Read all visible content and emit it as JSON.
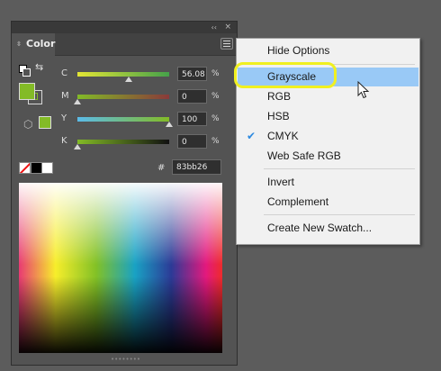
{
  "panel": {
    "tab_label": "Color",
    "tab_arrows": "⇳",
    "collapse_glyph": "‹‹",
    "close_glyph": "×",
    "fill_color": "#83bb26",
    "sliders": [
      {
        "key": "C",
        "value": "56.08",
        "unit": "%",
        "level": 0.56,
        "gradient": "linear-gradient(to right,#e3e635,#45a14a)"
      },
      {
        "key": "M",
        "value": "0",
        "unit": "%",
        "level": 0.0,
        "gradient": "linear-gradient(to right,#82ba27,#8a3a3a)"
      },
      {
        "key": "Y",
        "value": "100",
        "unit": "%",
        "level": 1.0,
        "gradient": "linear-gradient(to right,#5bbbe8,#83bb26)"
      },
      {
        "key": "K",
        "value": "0",
        "unit": "%",
        "level": 0.0,
        "gradient": "linear-gradient(to right,#83bb26,#111111)"
      }
    ],
    "hash_label": "#",
    "hex_value": "83bb26",
    "grip": "••••••••"
  },
  "menu": {
    "items": [
      {
        "label": "Hide Options",
        "checked": false,
        "highlighted": false
      },
      {
        "label": "Grayscale",
        "checked": false,
        "highlighted": true
      },
      {
        "label": "RGB",
        "checked": false,
        "highlighted": false
      },
      {
        "label": "HSB",
        "checked": false,
        "highlighted": false
      },
      {
        "label": "CMYK",
        "checked": true,
        "highlighted": false
      },
      {
        "label": "Web Safe RGB",
        "checked": false,
        "highlighted": false
      },
      {
        "label": "Invert",
        "checked": false,
        "highlighted": false
      },
      {
        "label": "Complement",
        "checked": false,
        "highlighted": false
      },
      {
        "label": "Create New Swatch...",
        "checked": false,
        "highlighted": false
      }
    ],
    "checkmark": "✔"
  },
  "annotation_color": "#f0f020"
}
